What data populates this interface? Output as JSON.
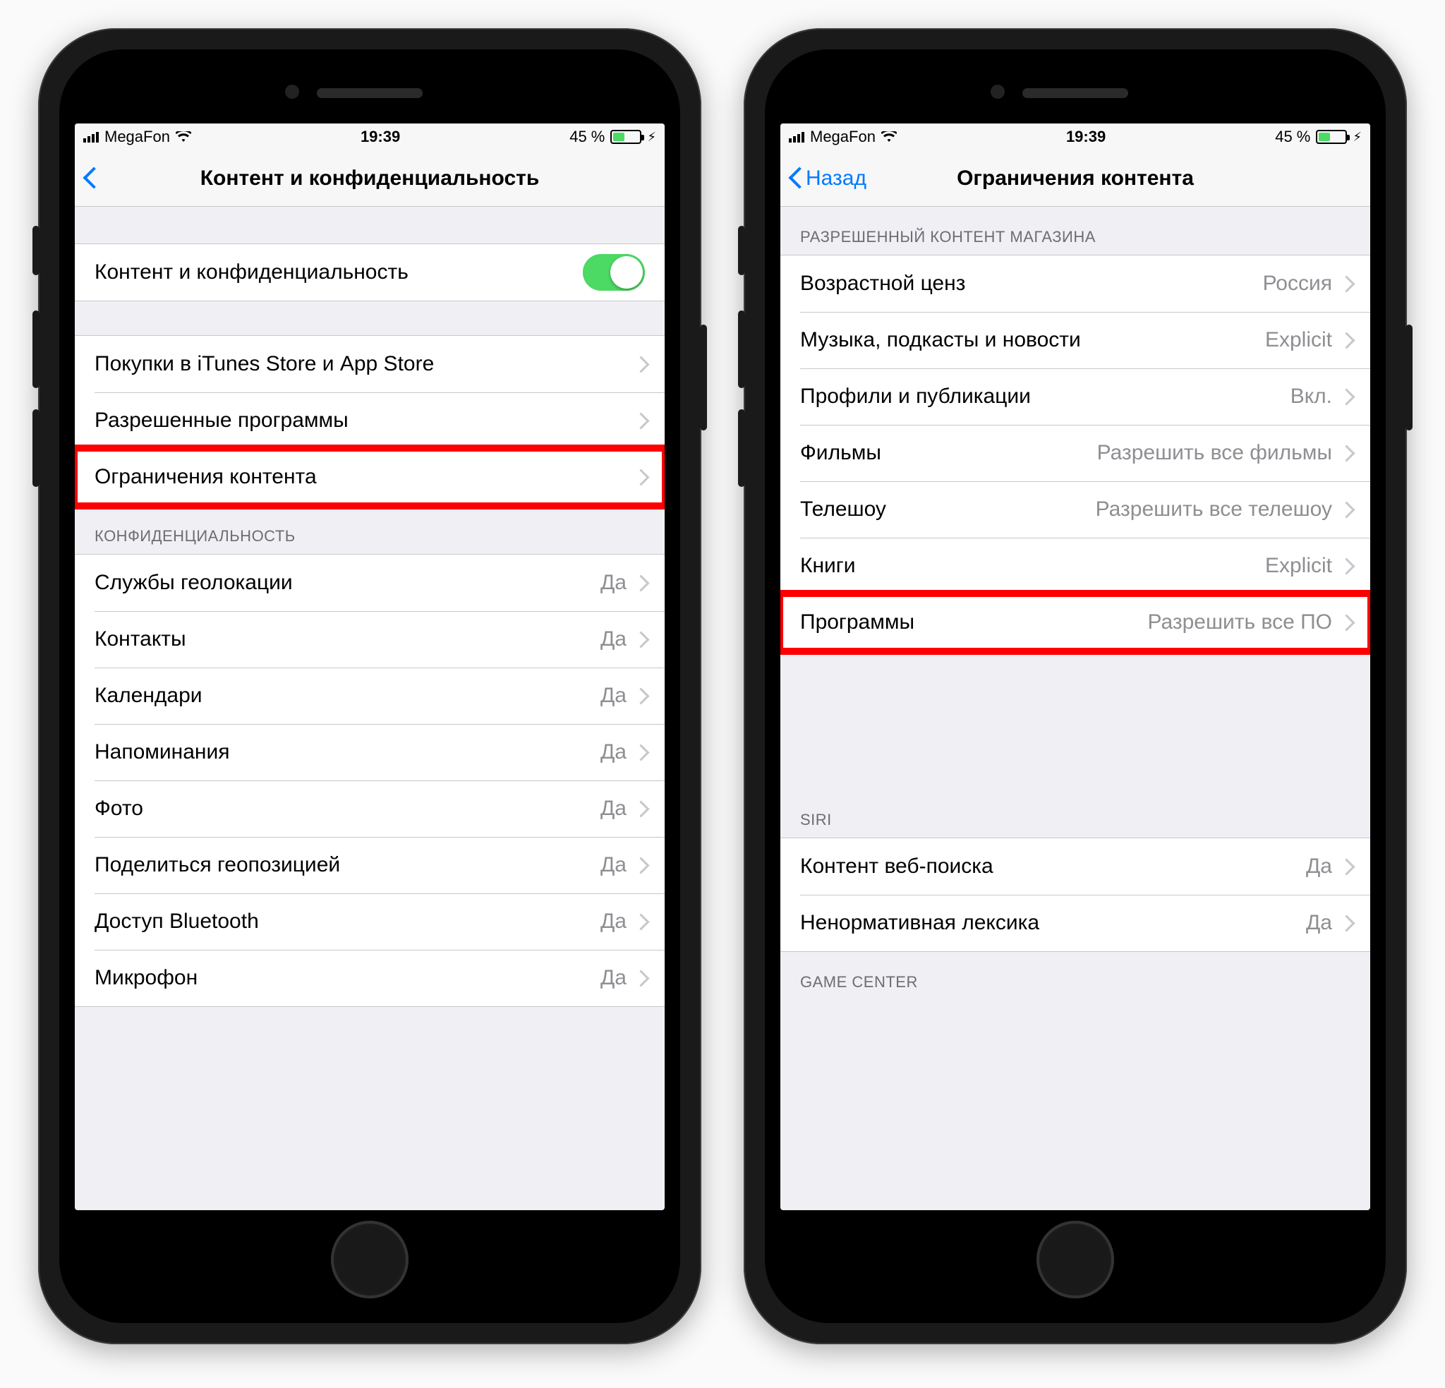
{
  "statusbar": {
    "carrier": "MegaFon",
    "time": "19:39",
    "battery_pct": "45 %"
  },
  "left": {
    "title": "Контент и конфиденциальность",
    "toggle_row_label": "Контент и конфиденциальность",
    "group2": [
      {
        "label": "Покупки в iTunes Store и App Store"
      },
      {
        "label": "Разрешенные программы"
      },
      {
        "label": "Ограничения контента",
        "highlight": true
      }
    ],
    "privacy_header": "КОНФИДЕНЦИАЛЬНОСТЬ",
    "privacy_rows": [
      {
        "label": "Службы геолокации",
        "value": "Да"
      },
      {
        "label": "Контакты",
        "value": "Да"
      },
      {
        "label": "Календари",
        "value": "Да"
      },
      {
        "label": "Напоминания",
        "value": "Да"
      },
      {
        "label": "Фото",
        "value": "Да"
      },
      {
        "label": "Поделиться геопозицией",
        "value": "Да"
      },
      {
        "label": "Доступ Bluetooth",
        "value": "Да"
      },
      {
        "label": "Микрофон",
        "value": "Да"
      }
    ]
  },
  "right": {
    "back_label": "Назад",
    "title": "Ограничения контента",
    "store_header": "РАЗРЕШЕННЫЙ КОНТЕНТ МАГАЗИНА",
    "store_rows": [
      {
        "label": "Возрастной ценз",
        "value": "Россия"
      },
      {
        "label": "Музыка, подкасты и новости",
        "value": "Explicit"
      },
      {
        "label": "Профили и публикации",
        "value": "Вкл."
      },
      {
        "label": "Фильмы",
        "value": "Разрешить все фильмы"
      },
      {
        "label": "Телешоу",
        "value": "Разрешить все телешоу"
      },
      {
        "label": "Книги",
        "value": "Explicit"
      },
      {
        "label": "Программы",
        "value": "Разрешить все ПО",
        "highlight": true
      }
    ],
    "siri_header": "SIRI",
    "siri_rows": [
      {
        "label": "Контент веб-поиска",
        "value": "Да"
      },
      {
        "label": "Ненормативная лексика",
        "value": "Да"
      }
    ],
    "gamecenter_header": "GAME CENTER"
  }
}
